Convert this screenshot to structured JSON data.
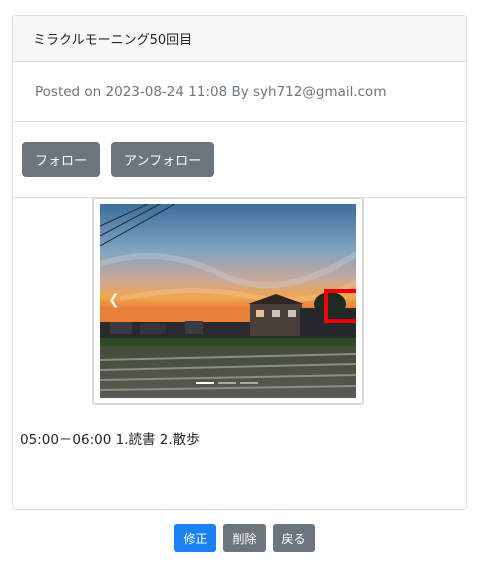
{
  "post": {
    "title": "ミラクルモーニング50回目",
    "meta": "Posted on 2023-08-24 11:08 By syh712@gmail.com",
    "body": "05:00－06:00 1.読書 2.散歩"
  },
  "actions": {
    "follow_label": "フォロー",
    "unfollow_label": "アンフォロー"
  },
  "carousel": {
    "slide_count": 3,
    "active_index": 0,
    "prev_icon": "chevron-left-icon"
  },
  "footer_buttons": {
    "edit_label": "修正",
    "delete_label": "削除",
    "back_label": "戻る"
  },
  "colors": {
    "primary": "#1a82f5",
    "secondary": "#6c757d",
    "highlight": "#ee0000"
  }
}
